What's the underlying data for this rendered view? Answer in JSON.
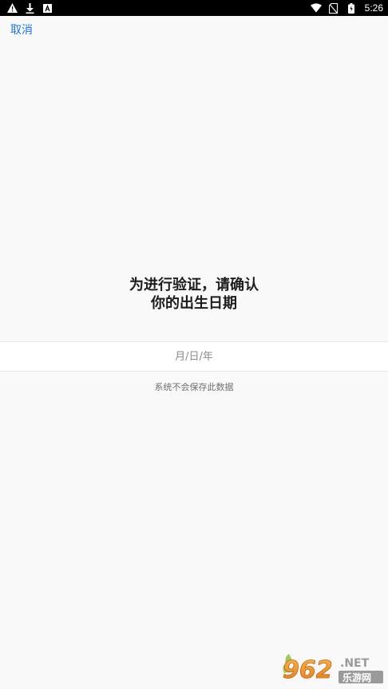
{
  "status_bar": {
    "time": "5:26",
    "left_icons": [
      "warning-icon",
      "download-icon",
      "font-icon"
    ],
    "right_icons": [
      "wifi-icon",
      "signal-off-icon",
      "battery-icon"
    ]
  },
  "header": {
    "cancel_label": "取消"
  },
  "prompt": {
    "title_line1": "为进行验证，请确认",
    "title_line2": "你的出生日期"
  },
  "birthdate": {
    "placeholder": "月/日/年",
    "value": ""
  },
  "privacy_note": "系统不会保存此数据",
  "watermark": {
    "logo_text": "962",
    "suffix": ".NET",
    "caption": "乐游网"
  },
  "colors": {
    "accent": "#1a73e8",
    "background": "#f9f9f9",
    "status_bar": "#000000"
  }
}
